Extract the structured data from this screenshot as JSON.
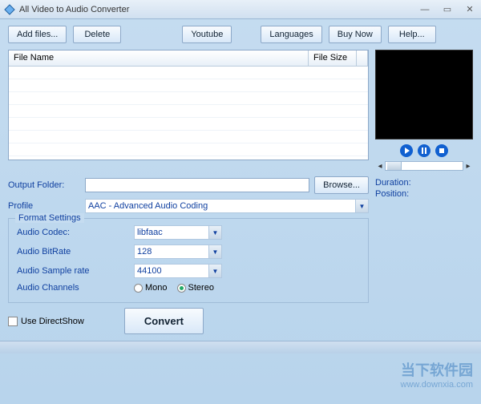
{
  "window": {
    "title": "All Video to Audio Converter"
  },
  "toolbar": {
    "add_files": "Add files...",
    "delete": "Delete",
    "youtube": "Youtube",
    "languages": "Languages",
    "buy_now": "Buy Now",
    "help": "Help..."
  },
  "grid": {
    "col_filename": "File Name",
    "col_filesize": "File Size",
    "rows": []
  },
  "preview": {
    "duration_label": "Duration:",
    "duration_value": "",
    "position_label": "Position:",
    "position_value": ""
  },
  "output": {
    "label": "Output Folder:",
    "value": "",
    "browse": "Browse..."
  },
  "profile": {
    "label": "Profile",
    "value": "AAC - Advanced Audio Coding"
  },
  "format": {
    "legend": "Format Settings",
    "codec_label": "Audio Codec:",
    "codec_value": "libfaac",
    "bitrate_label": "Audio BitRate",
    "bitrate_value": "128",
    "sample_label": "Audio Sample rate",
    "sample_value": "44100",
    "channels_label": "Audio Channels",
    "mono": "Mono",
    "stereo": "Stereo",
    "channels_selected": "stereo"
  },
  "directshow": {
    "label": "Use DirectShow",
    "checked": false
  },
  "convert": {
    "label": "Convert"
  },
  "watermark": {
    "brand": "当下软件园",
    "url": "www.downxia.com"
  }
}
